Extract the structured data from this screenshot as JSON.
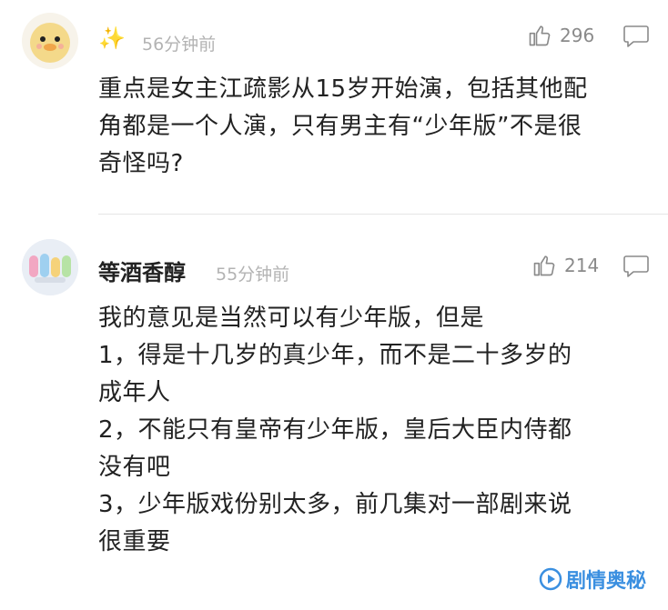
{
  "comments": [
    {
      "username": "✨",
      "time": "56分钟前",
      "likes": "296",
      "text": "重点是女主江疏影从15岁开始演，包括其他配\n角都是一个人演，只有男主有“少年版”不是很\n奇怪吗?"
    },
    {
      "username": "等酒香醇",
      "time": "55分钟前",
      "likes": "214",
      "text": "我的意见是当然可以有少年版，但是\n1，得是十几岁的真少年，而不是二十多岁的\n成年人\n2，不能只有皇帝有少年版，皇后大臣内侍都\n没有吧\n3，少年版戏份别太多，前几集对一部剧来说\n很重要"
    }
  ],
  "watermark": "剧情奥秘",
  "colors": {
    "text": "#222222",
    "meta": "#b3b3b3",
    "icon": "#8a8a8a",
    "watermark": "#3a8fe0"
  }
}
